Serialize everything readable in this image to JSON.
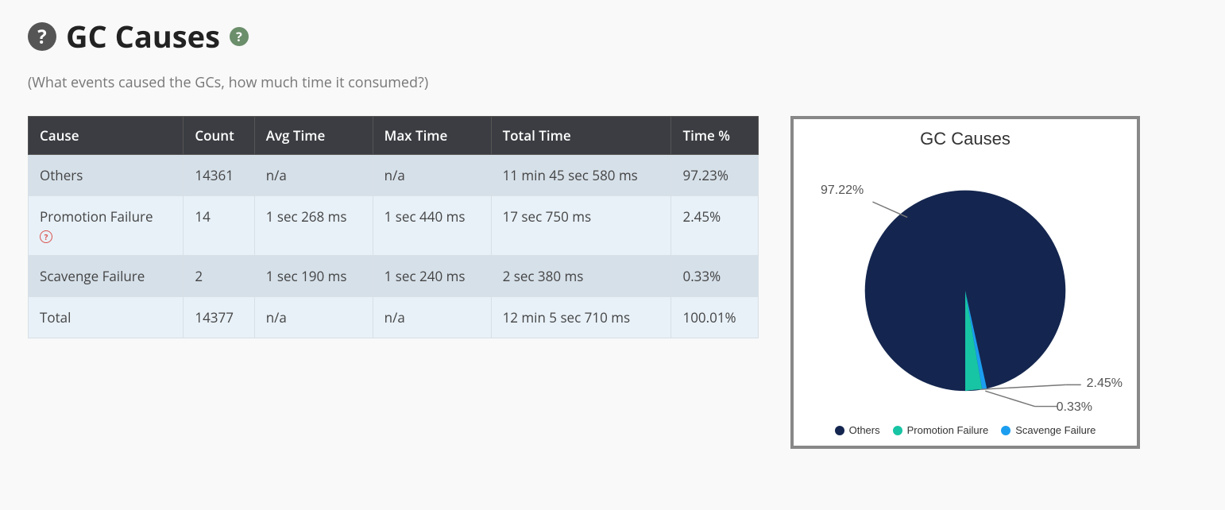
{
  "header": {
    "title": "GC Causes",
    "subtitle": "(What events caused the GCs, how much time it consumed?)"
  },
  "table": {
    "columns": [
      "Cause",
      "Count",
      "Avg Time",
      "Max Time",
      "Total Time",
      "Time %"
    ],
    "rows": [
      {
        "cause": "Others",
        "count": "14361",
        "avg": "n/a",
        "max": "n/a",
        "total": "11 min 45 sec 580 ms",
        "pct": "97.23%",
        "has_error_icon": false
      },
      {
        "cause": "Promotion Failure",
        "count": "14",
        "avg": "1 sec 268 ms",
        "max": "1 sec 440 ms",
        "total": "17 sec 750 ms",
        "pct": "2.45%",
        "has_error_icon": true
      },
      {
        "cause": "Scavenge Failure",
        "count": "2",
        "avg": "1 sec 190 ms",
        "max": "1 sec 240 ms",
        "total": "2 sec 380 ms",
        "pct": "0.33%",
        "has_error_icon": false
      },
      {
        "cause": "Total",
        "count": "14377",
        "avg": "n/a",
        "max": "n/a",
        "total": "12 min 5 sec 710 ms",
        "pct": "100.01%",
        "has_error_icon": false
      }
    ]
  },
  "chart": {
    "title": "GC Causes",
    "labels": {
      "others": "97.22%",
      "promotion": "2.45%",
      "scavenge": "0.33%"
    },
    "legend": {
      "others": "Others",
      "promotion": "Promotion Failure",
      "scavenge": "Scavenge Failure"
    },
    "colors": {
      "others": "#14264f",
      "promotion": "#17c4a4",
      "scavenge": "#1b9ef0"
    }
  },
  "chart_data": {
    "type": "pie",
    "title": "GC Causes",
    "series": [
      {
        "name": "Others",
        "value": 97.22,
        "color": "#14264f"
      },
      {
        "name": "Promotion Failure",
        "value": 2.45,
        "color": "#17c4a4"
      },
      {
        "name": "Scavenge Failure",
        "value": 0.33,
        "color": "#1b9ef0"
      }
    ],
    "unit": "percent"
  }
}
